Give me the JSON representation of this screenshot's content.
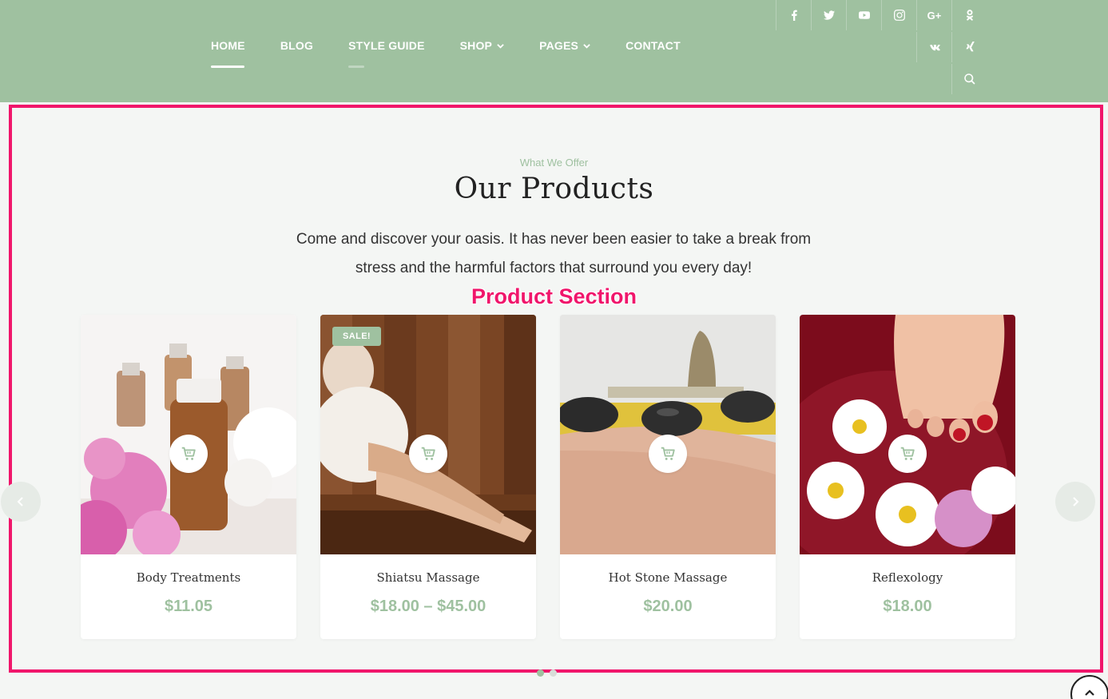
{
  "nav": {
    "items": [
      {
        "label": "HOME",
        "dropdown": false
      },
      {
        "label": "BLOG",
        "dropdown": false
      },
      {
        "label": "STYLE GUIDE",
        "dropdown": false
      },
      {
        "label": "SHOP",
        "dropdown": true
      },
      {
        "label": "PAGES",
        "dropdown": true
      },
      {
        "label": "CONTACT",
        "dropdown": false
      }
    ],
    "active": "HOME"
  },
  "social": {
    "icons": [
      "facebook-icon",
      "twitter-icon",
      "youtube-icon",
      "instagram-icon",
      "google-plus-icon",
      "odnoklassniki-icon",
      "vk-icon",
      "xing-icon",
      "search-icon"
    ],
    "google_plus_label": "G+"
  },
  "products_section": {
    "eyebrow": "What We Offer",
    "title": "Our Products",
    "description": "Come and discover your oasis. It has never been easier to take a break from stress and the harmful factors that surround you every day!",
    "annotation": "Product Section",
    "products": [
      {
        "name": "Body Treatments",
        "price": "$11.05",
        "badge": ""
      },
      {
        "name": "Shiatsu Massage",
        "price": "$18.00 – $45.00",
        "badge": "SALE!"
      },
      {
        "name": "Hot Stone Massage",
        "price": "$20.00",
        "badge": ""
      },
      {
        "name": "Reflexology",
        "price": "$18.00",
        "badge": ""
      }
    ]
  },
  "colors": {
    "brand_green": "#9fc1a0",
    "annotation_pink": "#f0166b",
    "page_bg": "#f4f6f4"
  }
}
